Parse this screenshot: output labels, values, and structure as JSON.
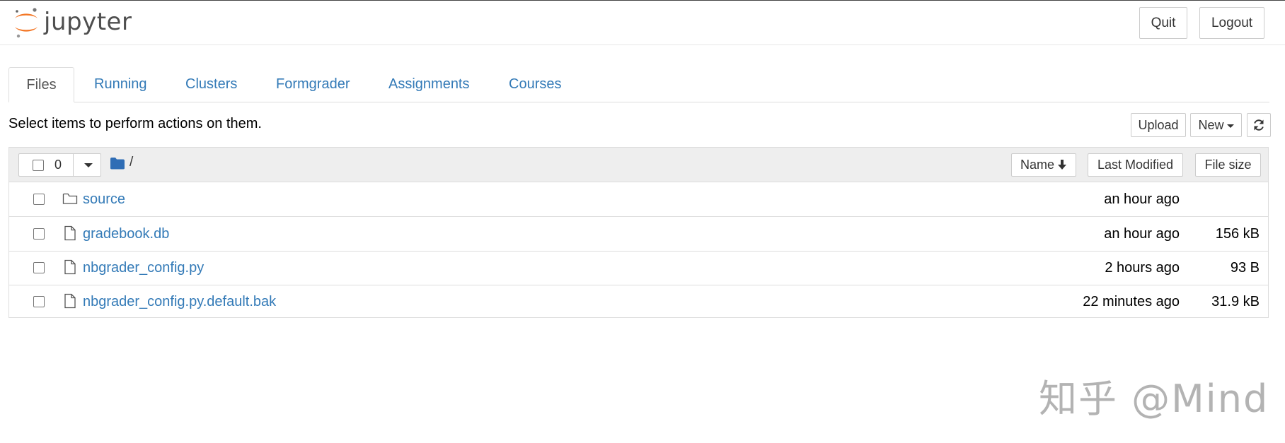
{
  "header": {
    "logo_text": "jupyter",
    "quit_label": "Quit",
    "logout_label": "Logout"
  },
  "tabs": [
    {
      "label": "Files",
      "active": true
    },
    {
      "label": "Running",
      "active": false
    },
    {
      "label": "Clusters",
      "active": false
    },
    {
      "label": "Formgrader",
      "active": false
    },
    {
      "label": "Assignments",
      "active": false
    },
    {
      "label": "Courses",
      "active": false
    }
  ],
  "toolbar": {
    "hint": "Select items to perform actions on them.",
    "upload_label": "Upload",
    "new_label": "New"
  },
  "list_header": {
    "selected_count": "0",
    "breadcrumb": "/",
    "name_label": "Name",
    "last_modified_label": "Last Modified",
    "file_size_label": "File size"
  },
  "files": [
    {
      "name": "source",
      "type": "folder",
      "modified": "an hour ago",
      "size": ""
    },
    {
      "name": "gradebook.db",
      "type": "file",
      "modified": "an hour ago",
      "size": "156 kB"
    },
    {
      "name": "nbgrader_config.py",
      "type": "file",
      "modified": "2 hours ago",
      "size": "93 B"
    },
    {
      "name": "nbgrader_config.py.default.bak",
      "type": "file",
      "modified": "22 minutes ago",
      "size": "31.9 kB"
    }
  ],
  "watermark": "知乎 @Mind",
  "colors": {
    "link": "#337ab7",
    "logo_orange": "#f37726",
    "header_bg": "#eeeeee"
  },
  "icons": {
    "folder": "folder-icon",
    "file": "file-icon",
    "refresh": "refresh-icon",
    "sort": "arrow-down-icon"
  }
}
